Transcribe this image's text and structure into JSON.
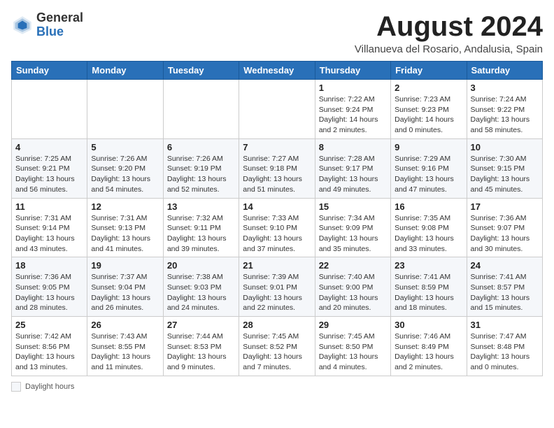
{
  "header": {
    "logo": {
      "general": "General",
      "blue": "Blue"
    },
    "month_year": "August 2024",
    "location": "Villanueva del Rosario, Andalusia, Spain"
  },
  "weekdays": [
    "Sunday",
    "Monday",
    "Tuesday",
    "Wednesday",
    "Thursday",
    "Friday",
    "Saturday"
  ],
  "weeks": [
    [
      {
        "day": "",
        "info": ""
      },
      {
        "day": "",
        "info": ""
      },
      {
        "day": "",
        "info": ""
      },
      {
        "day": "",
        "info": ""
      },
      {
        "day": "1",
        "info": "Sunrise: 7:22 AM\nSunset: 9:24 PM\nDaylight: 14 hours\nand 2 minutes."
      },
      {
        "day": "2",
        "info": "Sunrise: 7:23 AM\nSunset: 9:23 PM\nDaylight: 14 hours\nand 0 minutes."
      },
      {
        "day": "3",
        "info": "Sunrise: 7:24 AM\nSunset: 9:22 PM\nDaylight: 13 hours\nand 58 minutes."
      }
    ],
    [
      {
        "day": "4",
        "info": "Sunrise: 7:25 AM\nSunset: 9:21 PM\nDaylight: 13 hours\nand 56 minutes."
      },
      {
        "day": "5",
        "info": "Sunrise: 7:26 AM\nSunset: 9:20 PM\nDaylight: 13 hours\nand 54 minutes."
      },
      {
        "day": "6",
        "info": "Sunrise: 7:26 AM\nSunset: 9:19 PM\nDaylight: 13 hours\nand 52 minutes."
      },
      {
        "day": "7",
        "info": "Sunrise: 7:27 AM\nSunset: 9:18 PM\nDaylight: 13 hours\nand 51 minutes."
      },
      {
        "day": "8",
        "info": "Sunrise: 7:28 AM\nSunset: 9:17 PM\nDaylight: 13 hours\nand 49 minutes."
      },
      {
        "day": "9",
        "info": "Sunrise: 7:29 AM\nSunset: 9:16 PM\nDaylight: 13 hours\nand 47 minutes."
      },
      {
        "day": "10",
        "info": "Sunrise: 7:30 AM\nSunset: 9:15 PM\nDaylight: 13 hours\nand 45 minutes."
      }
    ],
    [
      {
        "day": "11",
        "info": "Sunrise: 7:31 AM\nSunset: 9:14 PM\nDaylight: 13 hours\nand 43 minutes."
      },
      {
        "day": "12",
        "info": "Sunrise: 7:31 AM\nSunset: 9:13 PM\nDaylight: 13 hours\nand 41 minutes."
      },
      {
        "day": "13",
        "info": "Sunrise: 7:32 AM\nSunset: 9:11 PM\nDaylight: 13 hours\nand 39 minutes."
      },
      {
        "day": "14",
        "info": "Sunrise: 7:33 AM\nSunset: 9:10 PM\nDaylight: 13 hours\nand 37 minutes."
      },
      {
        "day": "15",
        "info": "Sunrise: 7:34 AM\nSunset: 9:09 PM\nDaylight: 13 hours\nand 35 minutes."
      },
      {
        "day": "16",
        "info": "Sunrise: 7:35 AM\nSunset: 9:08 PM\nDaylight: 13 hours\nand 33 minutes."
      },
      {
        "day": "17",
        "info": "Sunrise: 7:36 AM\nSunset: 9:07 PM\nDaylight: 13 hours\nand 30 minutes."
      }
    ],
    [
      {
        "day": "18",
        "info": "Sunrise: 7:36 AM\nSunset: 9:05 PM\nDaylight: 13 hours\nand 28 minutes."
      },
      {
        "day": "19",
        "info": "Sunrise: 7:37 AM\nSunset: 9:04 PM\nDaylight: 13 hours\nand 26 minutes."
      },
      {
        "day": "20",
        "info": "Sunrise: 7:38 AM\nSunset: 9:03 PM\nDaylight: 13 hours\nand 24 minutes."
      },
      {
        "day": "21",
        "info": "Sunrise: 7:39 AM\nSunset: 9:01 PM\nDaylight: 13 hours\nand 22 minutes."
      },
      {
        "day": "22",
        "info": "Sunrise: 7:40 AM\nSunset: 9:00 PM\nDaylight: 13 hours\nand 20 minutes."
      },
      {
        "day": "23",
        "info": "Sunrise: 7:41 AM\nSunset: 8:59 PM\nDaylight: 13 hours\nand 18 minutes."
      },
      {
        "day": "24",
        "info": "Sunrise: 7:41 AM\nSunset: 8:57 PM\nDaylight: 13 hours\nand 15 minutes."
      }
    ],
    [
      {
        "day": "25",
        "info": "Sunrise: 7:42 AM\nSunset: 8:56 PM\nDaylight: 13 hours\nand 13 minutes."
      },
      {
        "day": "26",
        "info": "Sunrise: 7:43 AM\nSunset: 8:55 PM\nDaylight: 13 hours\nand 11 minutes."
      },
      {
        "day": "27",
        "info": "Sunrise: 7:44 AM\nSunset: 8:53 PM\nDaylight: 13 hours\nand 9 minutes."
      },
      {
        "day": "28",
        "info": "Sunrise: 7:45 AM\nSunset: 8:52 PM\nDaylight: 13 hours\nand 7 minutes."
      },
      {
        "day": "29",
        "info": "Sunrise: 7:45 AM\nSunset: 8:50 PM\nDaylight: 13 hours\nand 4 minutes."
      },
      {
        "day": "30",
        "info": "Sunrise: 7:46 AM\nSunset: 8:49 PM\nDaylight: 13 hours\nand 2 minutes."
      },
      {
        "day": "31",
        "info": "Sunrise: 7:47 AM\nSunset: 8:48 PM\nDaylight: 13 hours\nand 0 minutes."
      }
    ]
  ],
  "footer": {
    "label": "Daylight hours"
  }
}
